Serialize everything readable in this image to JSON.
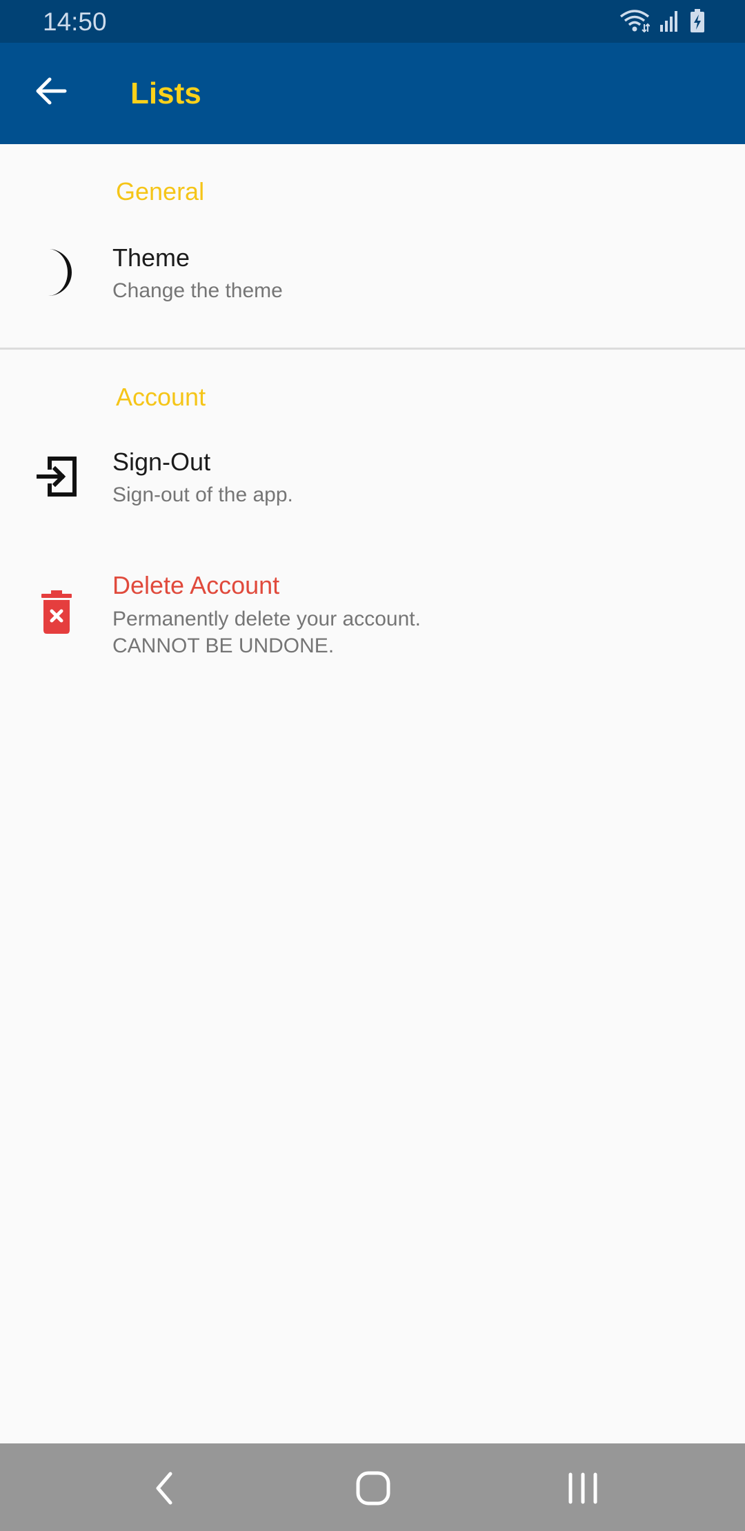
{
  "status_bar": {
    "time": "14:50",
    "icons": [
      "wifi-icon",
      "signal-icon",
      "battery-charging-icon"
    ]
  },
  "app_bar": {
    "title": "Lists",
    "back_icon": "arrow-left-icon",
    "background_color": "#01508f",
    "title_color": "#fdd11a"
  },
  "sections": [
    {
      "header": "General",
      "items": [
        {
          "icon": "moon-icon",
          "title": "Theme",
          "subtitle": "Change the theme"
        }
      ]
    },
    {
      "header": "Account",
      "items": [
        {
          "icon": "sign-out-icon",
          "title": "Sign-Out",
          "subtitle": "Sign-out of the app."
        },
        {
          "icon": "trash-x-icon",
          "title": "Delete Account",
          "subtitle": "Permanently delete your account.\nCANNOT BE UNDONE.",
          "title_color": "#e04a3c"
        }
      ]
    }
  ],
  "colors": {
    "section_header": "#f5c518",
    "danger": "#e04a3c"
  },
  "nav_bar": {
    "buttons": [
      "back-nav-icon",
      "home-nav-icon",
      "recents-nav-icon"
    ]
  }
}
